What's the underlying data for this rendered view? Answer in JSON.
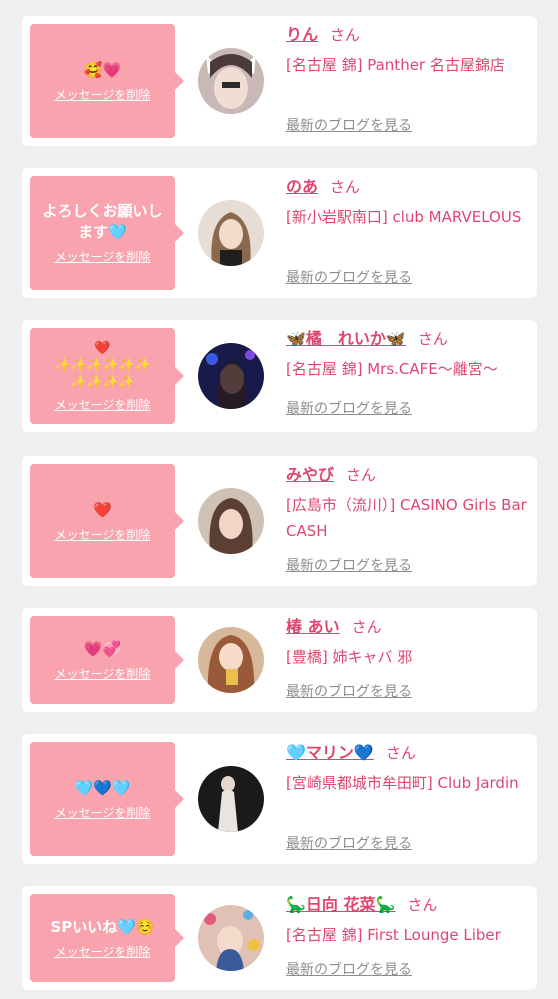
{
  "common": {
    "delete_label": "メッセージを削除",
    "san_label": "さん",
    "blog_label": "最新のブログを見る"
  },
  "colors": {
    "bubble": "#f8a3ad",
    "name": "#e04570",
    "link_gray": "#8e8e8e",
    "background": "#efefef"
  },
  "cards": [
    {
      "message": "🥰💗",
      "name": "りん",
      "shop": "[名古屋 錦] Panther 名古屋錦店",
      "avatar_icon": "profile-photo"
    },
    {
      "message": "よろしくお願いします🩵",
      "name": "のあ",
      "shop": "[新小岩駅南口] club MARVELOUS",
      "avatar_icon": "profile-photo"
    },
    {
      "message": "❤️\n✨✨✨✨✨✨\n✨✨✨✨",
      "name": "🦋橘　れいか🦋",
      "shop": "[名古屋 錦] Mrs.CAFE〜離宮〜",
      "avatar_icon": "profile-photo"
    },
    {
      "message": "❤️",
      "name": "みやび",
      "shop": "[広島市（流川）] CASINO Girls Bar CASH",
      "avatar_icon": "profile-photo"
    },
    {
      "message": "💗💞",
      "name": "椿 あい",
      "shop": "[豊橋] 姉キャバ 邪",
      "avatar_icon": "profile-photo"
    },
    {
      "message": "🩵💙🩵",
      "name": "🩵マリン💙",
      "shop": "[宮崎県都城市牟田町] Club Jardin",
      "avatar_icon": "profile-photo"
    },
    {
      "message": "SPいいね🩵☺️",
      "name": "🦕日向 花菜🦕",
      "shop": "[名古屋 錦] First Lounge Liber",
      "avatar_icon": "profile-photo"
    }
  ]
}
